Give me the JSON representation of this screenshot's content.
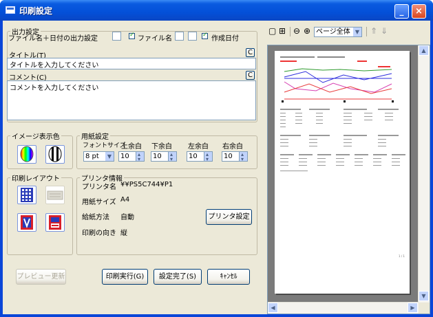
{
  "window": {
    "title": "印刷設定",
    "minimize": "_",
    "close": "×"
  },
  "output": {
    "legend": "出力設定",
    "filename_datetime_label": "ファイル名＋日付の出力設定",
    "filename_checkbox_label": "ファイル名",
    "date_checkbox_label": "作成日付",
    "title_label": "タイトル(T)",
    "title_value": "タイトルを入力してください",
    "comment_label": "コメント(C)",
    "comment_value": "コメントを入力してください",
    "clear_label": "C"
  },
  "image_color": {
    "legend": "イメージ表示色"
  },
  "paper": {
    "legend": "用紙設定",
    "font_size_label": "フォントサイズ",
    "font_size_value": "8 pt",
    "margin_top_label": "上余白",
    "margin_bottom_label": "下余白",
    "margin_left_label": "左余白",
    "margin_right_label": "右余白",
    "margin_top": "10",
    "margin_bottom": "10",
    "margin_left": "10",
    "margin_right": "10"
  },
  "layout": {
    "legend": "印刷レイアウト"
  },
  "printer": {
    "legend": "プリンタ情報",
    "name_label": "プリンタ名",
    "name_value": "¥¥PS5C744¥P1",
    "paper_size_label": "用紙サイズ",
    "paper_size_value": "A4",
    "feed_label": "給紙方法",
    "feed_value": "自動",
    "orientation_label": "印刷の向き",
    "orientation_value": "縦",
    "settings_button": "プリンタ設定"
  },
  "buttons": {
    "preview_update": "プレビュー更新",
    "print": "印刷実行(G)",
    "done": "設定完了(S)",
    "cancel": "ｷｬﾝｾﾙ"
  },
  "preview": {
    "zoom_value": "ページ全体",
    "page_number": "1 / 1"
  }
}
